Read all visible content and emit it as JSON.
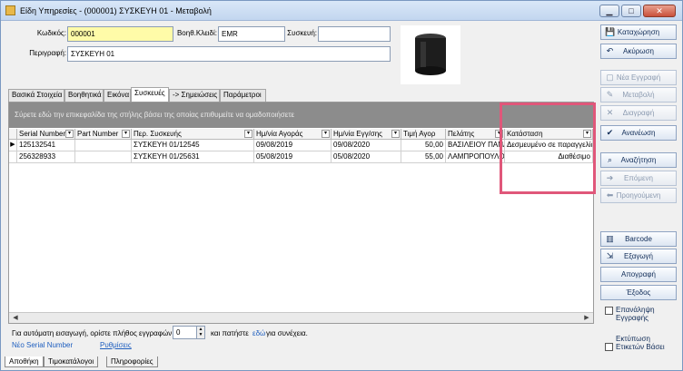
{
  "window": {
    "title": "Είδη Υπηρεσίες - (000001) ΣΥΣΚΕΥΗ 01 -  Μεταβολή",
    "min_label": "▁",
    "max_label": "□",
    "close_label": "✕"
  },
  "form": {
    "code_label": "Κωδικός:",
    "code_value": "000001",
    "aux_key_label": "Βοηθ.Κλειδί:",
    "aux_key_value": "EMR",
    "device_label": "Συσκευή:",
    "device_value": "",
    "description_label": "Περιγραφή:",
    "description_value": "ΣΥΣΚΕΥΗ 01"
  },
  "tabs": [
    {
      "label": "Βασικά Στοιχεία"
    },
    {
      "label": "Βοηθητικά"
    },
    {
      "label": "Εικόνα"
    },
    {
      "label": "Συσκευές"
    },
    {
      "label": "-> Σημειώσεις"
    },
    {
      "label": "Παράμετροι"
    }
  ],
  "grid": {
    "group_prompt": "Σύρετε εδώ την επικεφαλίδα της στήλης βάσει της οποίας επιθυμείτε να ομαδοποιήσετε",
    "columns": [
      "Serial Number",
      "Part Number",
      "Περ. Συσκευής",
      "Ημ/νία Αγοράς",
      "Ημ/νία Εγγ/σης",
      "Τιμή Αγορ",
      "Πελάτης",
      "Κατάσταση"
    ],
    "rows": [
      [
        "125132541",
        "",
        "ΣΥΣΚΕΥΗ 01/12545",
        "09/08/2019",
        "09/08/2020",
        "50,00",
        "ΒΑΣΙΛΕΙΟΥ ΠΑΝΑ",
        "Δεσμευμένο σε παραγγελία"
      ],
      [
        "256328933",
        "",
        "ΣΥΣΚΕΥΗ 01/25631",
        "05/08/2019",
        "05/08/2020",
        "55,00",
        "ΛΑΜΠΡΟΠΟΥΛΟΣ",
        "Διαθέσιμο"
      ]
    ]
  },
  "footer": {
    "auto_text": "Για αυτόματη εισαγωγή, ορίστε πλήθος εγγραφών",
    "count_value": "0",
    "after_text": "και πατήστε",
    "here_link": "εδώ",
    "continue_text": "για συνέχεια.",
    "new_serial_link": "Νέο Serial Number",
    "settings_link": "Ρυθμίσεις"
  },
  "bottom_tabs": [
    {
      "label": "Αποθήκη"
    },
    {
      "label": "Τιμοκατάλογοι"
    },
    {
      "label": "Πληροφορίες"
    }
  ],
  "sidebar": {
    "save": "Καταχώρηση",
    "cancel": "Ακύρωση",
    "new_record": "Νέα Εγγραφή",
    "modify": "Μεταβολή",
    "delete": "Διαγραφή",
    "refresh": "Ανανέωση",
    "search": "Αναζήτηση",
    "next": "Επόμενη",
    "previous": "Προηγούμενη",
    "barcode": "Barcode",
    "export": "Εξαγωγή",
    "save_as": "Απογραφή",
    "exit": "Έξοδος",
    "repeat_record": "Επανάληψη Εγγραφής",
    "print_labels": "Εκτύπωση Ετικετών Βάσει"
  },
  "colors": {
    "highlight": "#e0577a",
    "code_field_bg": "#fffba8",
    "group_bar": "#8c8c8c"
  }
}
